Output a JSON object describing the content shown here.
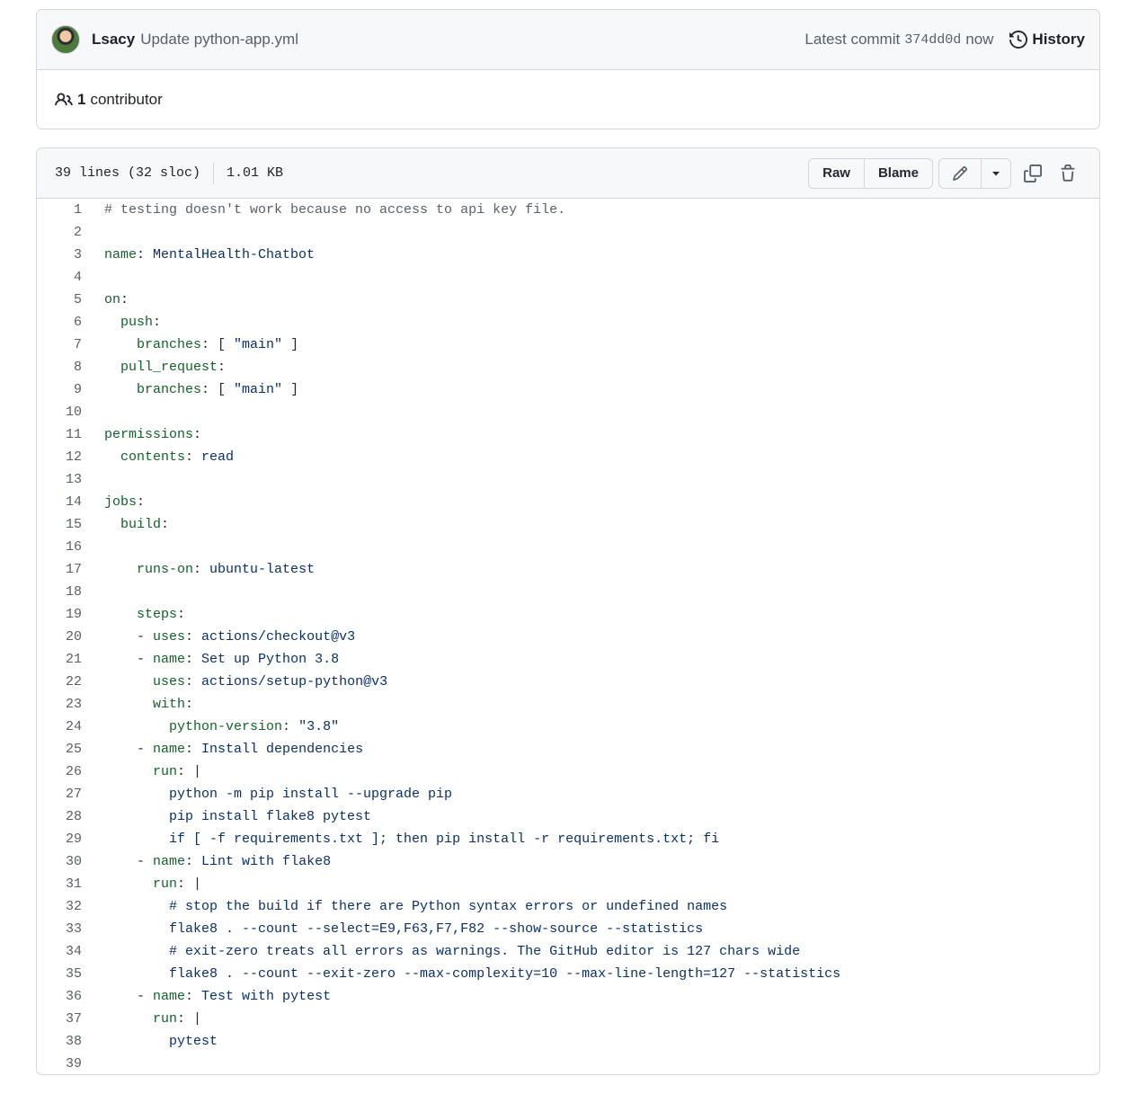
{
  "commit": {
    "author": "Lsacy",
    "message": "Update python-app.yml",
    "latest_label": "Latest commit",
    "sha": "374dd0d",
    "time": "now",
    "history_label": "History",
    "contributors_count": "1",
    "contributors_label": "contributor"
  },
  "file": {
    "lines_info": "39 lines (32 sloc)",
    "size": "1.01 KB",
    "raw_label": "Raw",
    "blame_label": "Blame"
  },
  "code_lines": [
    {
      "n": "1",
      "parts": [
        [
          "com",
          "# testing doesn't work because no access to api key file."
        ]
      ]
    },
    {
      "n": "2",
      "parts": []
    },
    {
      "n": "3",
      "parts": [
        [
          "key",
          "name"
        ],
        [
          "plain",
          ": "
        ],
        [
          "val",
          "MentalHealth-Chatbot"
        ]
      ]
    },
    {
      "n": "4",
      "parts": []
    },
    {
      "n": "5",
      "parts": [
        [
          "key",
          "on"
        ],
        [
          "plain",
          ":"
        ]
      ]
    },
    {
      "n": "6",
      "parts": [
        [
          "plain",
          "  "
        ],
        [
          "key",
          "push"
        ],
        [
          "plain",
          ":"
        ]
      ]
    },
    {
      "n": "7",
      "parts": [
        [
          "plain",
          "    "
        ],
        [
          "key",
          "branches"
        ],
        [
          "plain",
          ": [ "
        ],
        [
          "val",
          "\"main\""
        ],
        [
          "plain",
          " ]"
        ]
      ]
    },
    {
      "n": "8",
      "parts": [
        [
          "plain",
          "  "
        ],
        [
          "key",
          "pull_request"
        ],
        [
          "plain",
          ":"
        ]
      ]
    },
    {
      "n": "9",
      "parts": [
        [
          "plain",
          "    "
        ],
        [
          "key",
          "branches"
        ],
        [
          "plain",
          ": [ "
        ],
        [
          "val",
          "\"main\""
        ],
        [
          "plain",
          " ]"
        ]
      ]
    },
    {
      "n": "10",
      "parts": []
    },
    {
      "n": "11",
      "parts": [
        [
          "key",
          "permissions"
        ],
        [
          "plain",
          ":"
        ]
      ]
    },
    {
      "n": "12",
      "parts": [
        [
          "plain",
          "  "
        ],
        [
          "key",
          "contents"
        ],
        [
          "plain",
          ": "
        ],
        [
          "val",
          "read"
        ]
      ]
    },
    {
      "n": "13",
      "parts": []
    },
    {
      "n": "14",
      "parts": [
        [
          "key",
          "jobs"
        ],
        [
          "plain",
          ":"
        ]
      ]
    },
    {
      "n": "15",
      "parts": [
        [
          "plain",
          "  "
        ],
        [
          "key",
          "build"
        ],
        [
          "plain",
          ":"
        ]
      ]
    },
    {
      "n": "16",
      "parts": []
    },
    {
      "n": "17",
      "parts": [
        [
          "plain",
          "    "
        ],
        [
          "key",
          "runs-on"
        ],
        [
          "plain",
          ": "
        ],
        [
          "val",
          "ubuntu-latest"
        ]
      ]
    },
    {
      "n": "18",
      "parts": []
    },
    {
      "n": "19",
      "parts": [
        [
          "plain",
          "    "
        ],
        [
          "key",
          "steps"
        ],
        [
          "plain",
          ":"
        ]
      ]
    },
    {
      "n": "20",
      "parts": [
        [
          "plain",
          "    - "
        ],
        [
          "key",
          "uses"
        ],
        [
          "plain",
          ": "
        ],
        [
          "val",
          "actions/checkout@v3"
        ]
      ]
    },
    {
      "n": "21",
      "parts": [
        [
          "plain",
          "    - "
        ],
        [
          "key",
          "name"
        ],
        [
          "plain",
          ": "
        ],
        [
          "val",
          "Set up Python 3.8"
        ]
      ]
    },
    {
      "n": "22",
      "parts": [
        [
          "plain",
          "      "
        ],
        [
          "key",
          "uses"
        ],
        [
          "plain",
          ": "
        ],
        [
          "val",
          "actions/setup-python@v3"
        ]
      ]
    },
    {
      "n": "23",
      "parts": [
        [
          "plain",
          "      "
        ],
        [
          "key",
          "with"
        ],
        [
          "plain",
          ":"
        ]
      ]
    },
    {
      "n": "24",
      "parts": [
        [
          "plain",
          "        "
        ],
        [
          "key",
          "python-version"
        ],
        [
          "plain",
          ": "
        ],
        [
          "val",
          "\"3.8\""
        ]
      ]
    },
    {
      "n": "25",
      "parts": [
        [
          "plain",
          "    - "
        ],
        [
          "key",
          "name"
        ],
        [
          "plain",
          ": "
        ],
        [
          "val",
          "Install dependencies"
        ]
      ]
    },
    {
      "n": "26",
      "parts": [
        [
          "plain",
          "      "
        ],
        [
          "key",
          "run"
        ],
        [
          "plain",
          ": |"
        ]
      ]
    },
    {
      "n": "27",
      "parts": [
        [
          "val",
          "        python -m pip install --upgrade pip"
        ]
      ]
    },
    {
      "n": "28",
      "parts": [
        [
          "val",
          "        pip install flake8 pytest"
        ]
      ]
    },
    {
      "n": "29",
      "parts": [
        [
          "val",
          "        if [ -f requirements.txt ]; then pip install -r requirements.txt; fi"
        ]
      ]
    },
    {
      "n": "30",
      "parts": [
        [
          "plain",
          "    - "
        ],
        [
          "key",
          "name"
        ],
        [
          "plain",
          ": "
        ],
        [
          "val",
          "Lint with flake8"
        ]
      ]
    },
    {
      "n": "31",
      "parts": [
        [
          "plain",
          "      "
        ],
        [
          "key",
          "run"
        ],
        [
          "plain",
          ": |"
        ]
      ]
    },
    {
      "n": "32",
      "parts": [
        [
          "val",
          "        # stop the build if there are Python syntax errors or undefined names"
        ]
      ]
    },
    {
      "n": "33",
      "parts": [
        [
          "val",
          "        flake8 . --count --select=E9,F63,F7,F82 --show-source --statistics"
        ]
      ]
    },
    {
      "n": "34",
      "parts": [
        [
          "val",
          "        # exit-zero treats all errors as warnings. The GitHub editor is 127 chars wide"
        ]
      ]
    },
    {
      "n": "35",
      "parts": [
        [
          "val",
          "        flake8 . --count --exit-zero --max-complexity=10 --max-line-length=127 --statistics"
        ]
      ]
    },
    {
      "n": "36",
      "parts": [
        [
          "plain",
          "    - "
        ],
        [
          "key",
          "name"
        ],
        [
          "plain",
          ": "
        ],
        [
          "val",
          "Test with pytest"
        ]
      ]
    },
    {
      "n": "37",
      "parts": [
        [
          "plain",
          "      "
        ],
        [
          "key",
          "run"
        ],
        [
          "plain",
          ": |"
        ]
      ]
    },
    {
      "n": "38",
      "parts": [
        [
          "val",
          "        pytest"
        ]
      ]
    },
    {
      "n": "39",
      "parts": []
    }
  ]
}
